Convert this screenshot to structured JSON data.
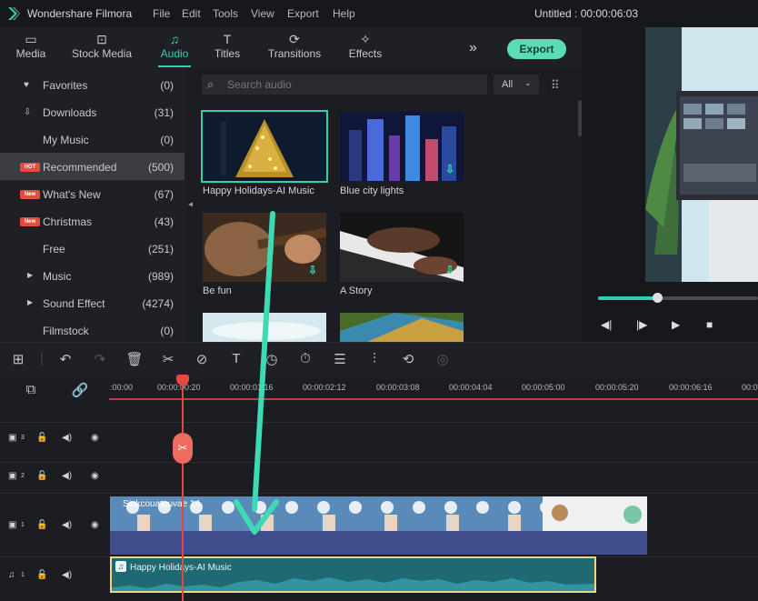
{
  "app": {
    "name": "Wondershare Filmora",
    "menu": [
      "File",
      "Edit",
      "Tools",
      "View",
      "Export",
      "Help"
    ],
    "document": "Untitled : 00:00:06:03"
  },
  "tabs": [
    {
      "label": "Media",
      "icon": "folder-icon"
    },
    {
      "label": "Stock Media",
      "icon": "stock-media-icon"
    },
    {
      "label": "Audio",
      "icon": "music-note-icon",
      "active": true
    },
    {
      "label": "Titles",
      "icon": "text-icon"
    },
    {
      "label": "Transitions",
      "icon": "transitions-icon"
    },
    {
      "label": "Effects",
      "icon": "effects-icon"
    }
  ],
  "more_symbol": "»",
  "export_label": "Export",
  "sidebar": {
    "items": [
      {
        "label": "Favorites",
        "count": "(0)",
        "icon": "heart-icon"
      },
      {
        "label": "Downloads",
        "count": "(31)",
        "icon": "download-icon"
      },
      {
        "label": "My Music",
        "count": "(0)"
      },
      {
        "label": "Recommended",
        "count": "(500)",
        "badge": "HOT",
        "active": true
      },
      {
        "label": "What's New",
        "count": "(67)",
        "badge": "New"
      },
      {
        "label": "Christmas",
        "count": "(43)",
        "badge": "New"
      },
      {
        "label": "Free",
        "count": "(251)"
      },
      {
        "label": "Music",
        "count": "(989)",
        "expandable": true
      },
      {
        "label": "Sound Effect",
        "count": "(4274)",
        "expandable": true
      },
      {
        "label": "Filmstock",
        "count": "(0)"
      }
    ]
  },
  "search": {
    "placeholder": "Search audio",
    "filter": "All"
  },
  "audio_items": [
    {
      "title": "Happy Holidays-AI Music",
      "selected": true
    },
    {
      "title": "Blue city lights",
      "downloadable": true
    },
    {
      "title": "Be fun",
      "downloadable": true
    },
    {
      "title": "A Story",
      "downloadable": true
    },
    {
      "title": ""
    },
    {
      "title": ""
    }
  ],
  "preview": {
    "progress": 0.37
  },
  "timeline": {
    "timecodes": [
      ":00:00",
      "00:00:00:20",
      "00:00:01:16",
      "00:00:02:12",
      "00:00:03:08",
      "00:00:04:04",
      "00:00:05:00",
      "00:00:05:20",
      "00:00:06:16",
      "00:0"
    ],
    "tracks": [
      {
        "label": "3",
        "type": "video"
      },
      {
        "label": "2",
        "type": "video"
      },
      {
        "label": "1",
        "type": "video"
      },
      {
        "label": "1",
        "type": "audio"
      }
    ],
    "video_clip_title": "Sinkcouatouvae 14",
    "audio_clip_title": "Happy Holidays-AI Music"
  },
  "colors": {
    "accent": "#33d1b0",
    "playhead": "#e8473e",
    "export": "#5bdcb4"
  }
}
